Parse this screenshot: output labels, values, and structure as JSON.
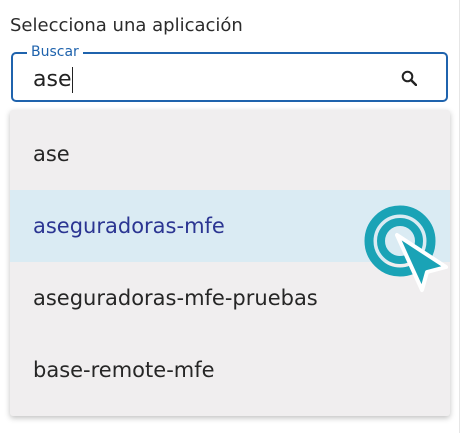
{
  "field": {
    "label": "Selecciona una aplicación",
    "legend": "Buscar",
    "value": "ase"
  },
  "icons": {
    "search": "search-icon",
    "cursor": "click-cursor-icon"
  },
  "colors": {
    "accent": "#1f63ad",
    "selected_bg": "#daebf3",
    "selected_text": "#2b3592",
    "cursor": "#1aa3b6"
  },
  "options": [
    {
      "label": "ase",
      "selected": false
    },
    {
      "label": "aseguradoras-mfe",
      "selected": true
    },
    {
      "label": "aseguradoras-mfe-pruebas",
      "selected": false
    },
    {
      "label": "base-remote-mfe",
      "selected": false
    }
  ]
}
